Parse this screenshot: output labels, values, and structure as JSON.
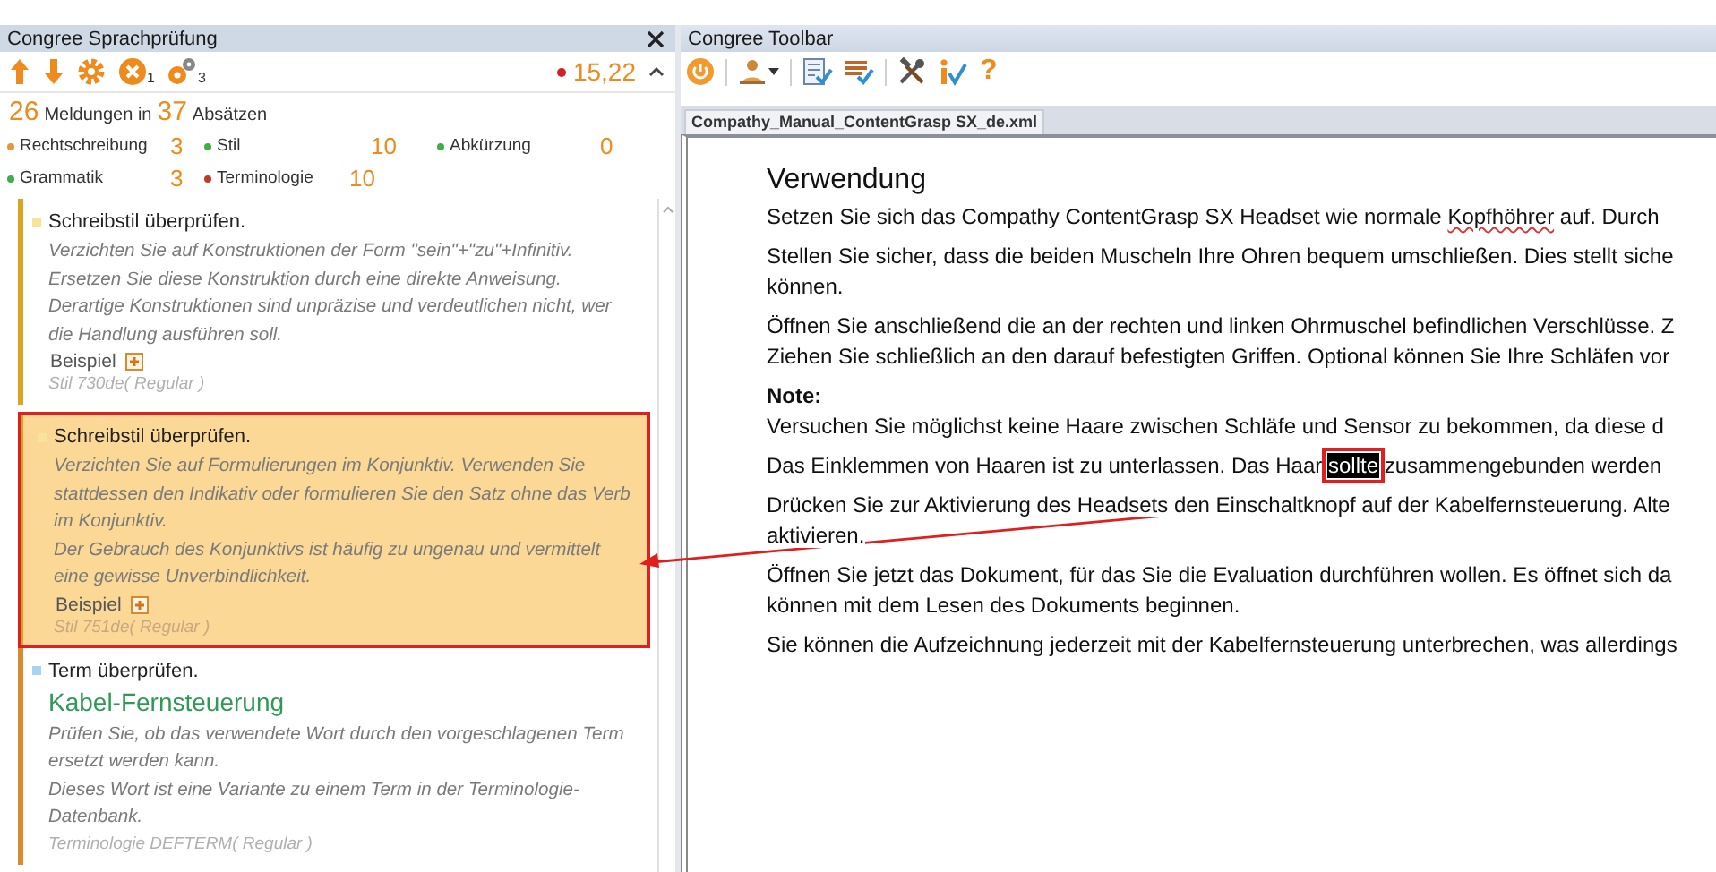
{
  "left_panel": {
    "title": "Congree Sprachprüfung",
    "toolbar": {
      "error_count": "1",
      "gear_count": "3",
      "score": "15,22"
    },
    "summary": {
      "messages": "26",
      "messages_label": "Meldungen in",
      "paragraphs": "37",
      "paragraphs_label": "Absätzen"
    },
    "categories": [
      {
        "label": "Rechtschreibung",
        "count": "3",
        "color": "#e8963a"
      },
      {
        "label": "Stil",
        "count": "10",
        "color": "#3cb043"
      },
      {
        "label": "Abkürzung",
        "count": "0",
        "color": "#3cb043"
      },
      {
        "label": "Grammatik",
        "count": "3",
        "color": "#3cb043"
      },
      {
        "label": "Terminologie",
        "count": "10",
        "color": "#c0392b"
      }
    ],
    "messages": [
      {
        "kind": "style",
        "selected": false,
        "color": "#f7e39a",
        "title": "Schreibstil überprüfen.",
        "description": "Verzichten Sie auf Konstruktionen der Form \"sein\"+\"zu\"+Infinitiv.\nErsetzen Sie diese Konstruktion durch eine direkte Anweisung.\nDerartige Konstruktionen sind unpräzise und verdeutlichen nicht, wer die Handlung ausführen soll.",
        "example": "Beispiel",
        "rule": "Stil 730de( Regular )"
      },
      {
        "kind": "style",
        "selected": true,
        "color": "#f7e39a",
        "title": "Schreibstil überprüfen.",
        "description": "Verzichten Sie auf Formulierungen im Konjunktiv. Verwenden Sie stattdessen den Indikativ oder formulieren Sie den Satz ohne das Verb im Konjunktiv.\nDer Gebrauch des Konjunktivs ist häufig zu ungenau und vermittelt eine gewisse Unverbindlichkeit.",
        "example": "Beispiel",
        "rule": "Stil 751de( Regular )"
      },
      {
        "kind": "term",
        "selected": false,
        "color": "#a9d3f0",
        "title": "Term überprüfen.",
        "term": "Kabel-Fernsteuerung",
        "description": "Prüfen Sie, ob das verwendete Wort durch den vorgeschlagenen Term ersetzt werden kann.\nDieses Wort ist eine Variante zu einem Term in der Terminologie-Datenbank.",
        "rule": "Terminologie DEFTERM( Regular )"
      }
    ]
  },
  "right_panel": {
    "title": "Congree Toolbar",
    "help": "?",
    "document_tab": "Compathy_Manual_ContentGrasp SX_de.xml",
    "paragraphs": [
      {
        "kind": "heading",
        "lines": [
          [
            {
              "text": "Verwendung"
            }
          ]
        ]
      },
      {
        "kind": "text",
        "lines": [
          [
            {
              "kind": "plain",
              "text": "Setzen Sie sich das Compathy ContentGrasp SX Headset wie normale "
            },
            {
              "kind": "misspelled",
              "text": "Kopfhöhrer"
            },
            {
              "kind": "plain",
              "text": " auf. Durch"
            }
          ]
        ]
      },
      {
        "kind": "text",
        "lines": [
          [
            {
              "text": "Stellen Sie sicher, dass die beiden Muscheln Ihre Ohren bequem umschließen. Dies stellt siche"
            }
          ],
          [
            {
              "text": "können."
            }
          ]
        ]
      },
      {
        "kind": "text",
        "lines": [
          [
            {
              "text": "Öffnen Sie anschließend die an der rechten und linken Ohrmuschel befindlichen Verschlüsse. Z"
            }
          ],
          [
            {
              "text": "Ziehen Sie schließlich an den darauf befestigten Griffen. Optional können Sie Ihre Schläfen vor"
            }
          ]
        ]
      },
      {
        "kind": "label",
        "lines": [
          [
            {
              "text": "Note:"
            }
          ]
        ]
      },
      {
        "kind": "text",
        "lines": [
          [
            {
              "text": "Versuchen Sie möglichst keine Haare zwischen Schläfe und Sensor zu bekommen, da diese d"
            }
          ]
        ]
      },
      {
        "kind": "text",
        "lines": [
          [
            {
              "kind": "plain",
              "text": "Das Einklemmen von Haaren ist zu unterlassen. Das Haar "
            },
            {
              "kind": "selected",
              "text": "sollte"
            },
            {
              "kind": "plain",
              "text": " zusammengebunden werden"
            }
          ]
        ]
      },
      {
        "kind": "text",
        "lines": [
          [
            {
              "text": "Drücken Sie zur Aktivierung des Headsets den Einschaltknopf auf der Kabelfernsteuerung. Alte"
            }
          ],
          [
            {
              "text": "aktivieren."
            }
          ]
        ]
      },
      {
        "kind": "text",
        "lines": [
          [
            {
              "text": "Öffnen Sie jetzt das Dokument, für das Sie die Evaluation durchführen wollen. Es öffnet sich da"
            }
          ],
          [
            {
              "text": "können mit dem Lesen des Dokuments beginnen."
            }
          ]
        ]
      },
      {
        "kind": "text",
        "lines": [
          [
            {
              "text": "Sie können die Aufzeichnung jederzeit mit der Kabelfernsteuerung unterbrechen, was allerdings"
            }
          ]
        ]
      }
    ]
  }
}
